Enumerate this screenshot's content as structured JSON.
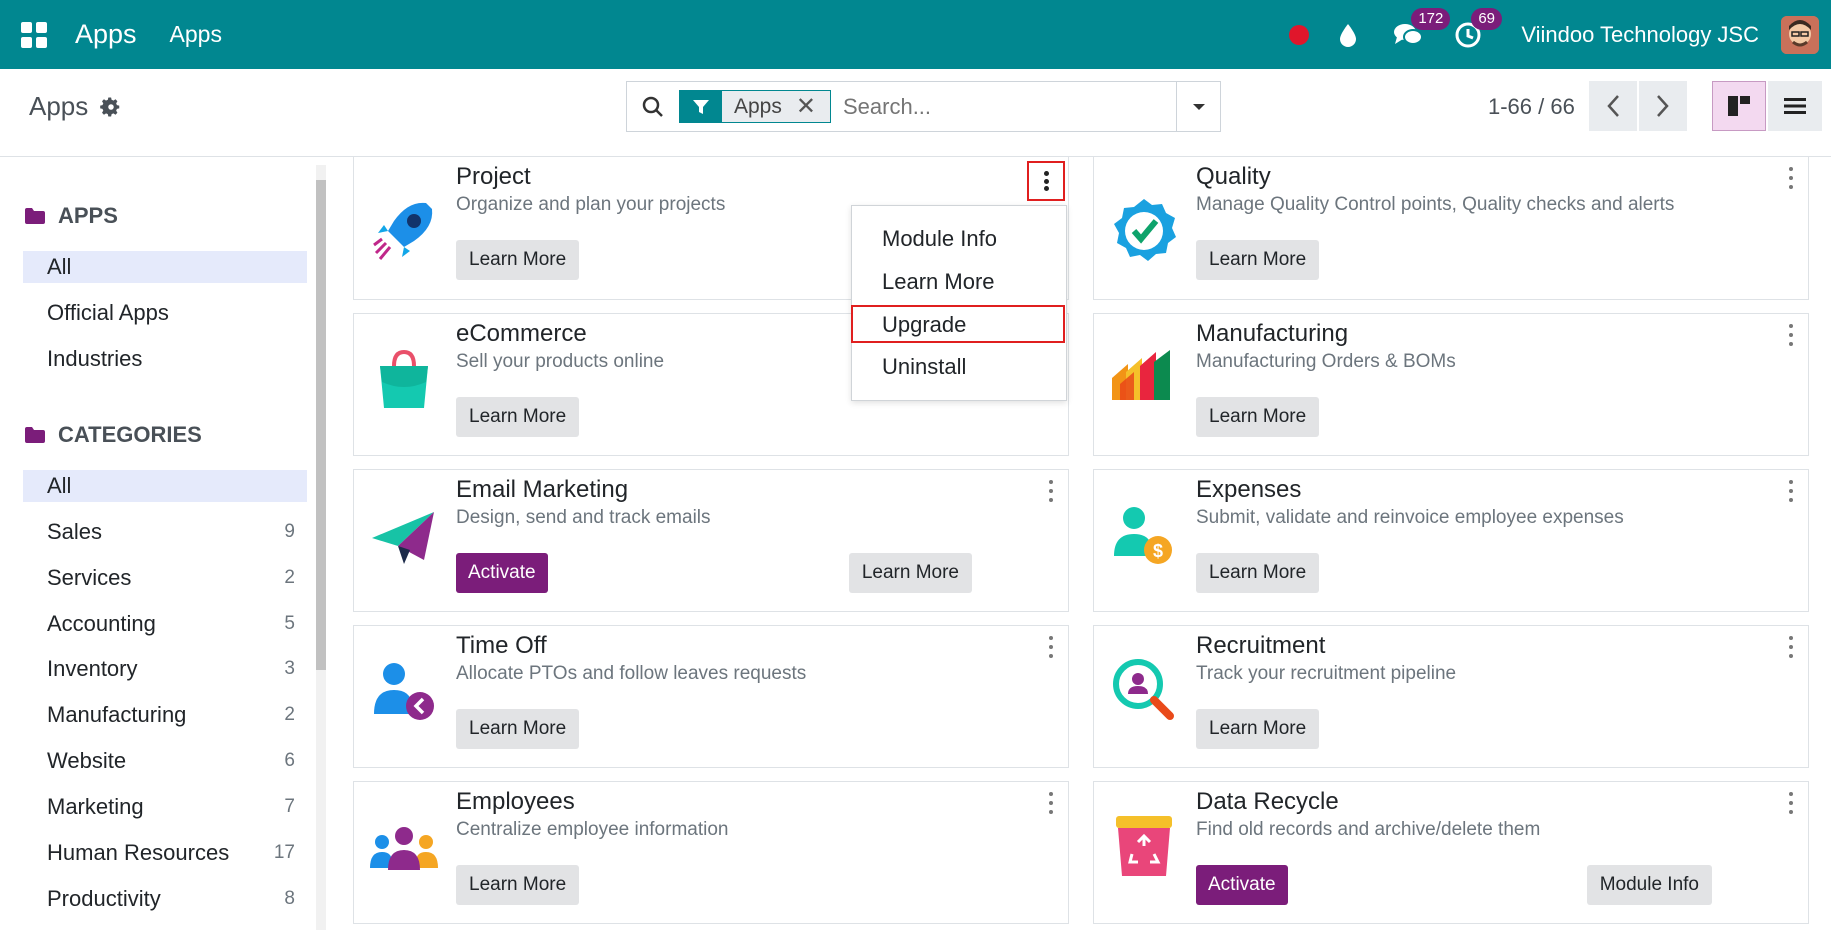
{
  "navbar": {
    "app_name": "Apps",
    "menu_item": "Apps",
    "messages_count": "172",
    "activities_count": "69",
    "company": "Viindoo Technology JSC"
  },
  "control_panel": {
    "title": "Apps",
    "facet_label": "Apps",
    "search_placeholder": "Search...",
    "pager": "1-66 / 66"
  },
  "sidebar": {
    "apps_header": "APPS",
    "apps_items": [
      {
        "label": "All"
      },
      {
        "label": "Official Apps"
      },
      {
        "label": "Industries"
      }
    ],
    "categories_header": "CATEGORIES",
    "category_items": [
      {
        "label": "All",
        "count": ""
      },
      {
        "label": "Sales",
        "count": "9"
      },
      {
        "label": "Services",
        "count": "2"
      },
      {
        "label": "Accounting",
        "count": "5"
      },
      {
        "label": "Inventory",
        "count": "3"
      },
      {
        "label": "Manufacturing",
        "count": "2"
      },
      {
        "label": "Website",
        "count": "6"
      },
      {
        "label": "Marketing",
        "count": "7"
      },
      {
        "label": "Human Resources",
        "count": "17"
      },
      {
        "label": "Productivity",
        "count": "8"
      }
    ]
  },
  "dropdown": {
    "items": [
      "Module Info",
      "Learn More",
      "Upgrade",
      "Uninstall"
    ]
  },
  "cards": [
    {
      "name": "Project",
      "summary": "Organize and plan your projects",
      "button": "Learn More"
    },
    {
      "name": "Quality",
      "summary": "Manage Quality Control points, Quality checks and alerts",
      "button": "Learn More"
    },
    {
      "name": "eCommerce",
      "summary": "Sell your products online",
      "button": "Learn More"
    },
    {
      "name": "Manufacturing",
      "summary": "Manufacturing Orders & BOMs",
      "button": "Learn More"
    },
    {
      "name": "Email Marketing",
      "summary": "Design, send and track emails",
      "button": "Activate",
      "button2": "Learn More"
    },
    {
      "name": "Expenses",
      "summary": "Submit, validate and reinvoice employee expenses",
      "button": "Learn More"
    },
    {
      "name": "Time Off",
      "summary": "Allocate PTOs and follow leaves requests",
      "button": "Learn More"
    },
    {
      "name": "Recruitment",
      "summary": "Track your recruitment pipeline",
      "button": "Learn More"
    },
    {
      "name": "Employees",
      "summary": "Centralize employee information",
      "button": "Learn More"
    },
    {
      "name": "Data Recycle",
      "summary": "Find old records and archive/delete them",
      "button": "Activate",
      "button2": "Module Info"
    }
  ],
  "colors": {
    "navbar": "#018790",
    "primary": "#7b1d7a",
    "highlight": "#e01f1f"
  }
}
